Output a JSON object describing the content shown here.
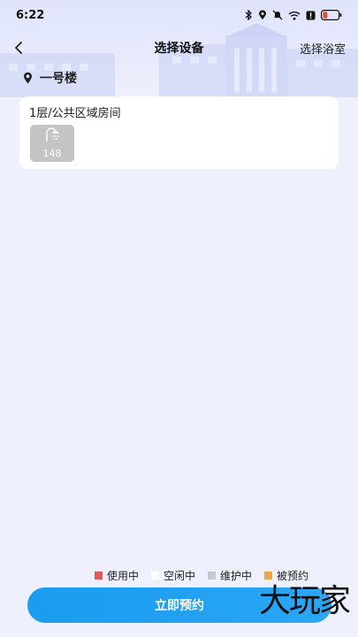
{
  "status_bar": {
    "time": "6:22",
    "icons": [
      "bluetooth-icon",
      "location-icon",
      "mute-icon",
      "wifi-icon",
      "alert-icon",
      "battery-icon"
    ]
  },
  "nav": {
    "title": "选择设备",
    "action_label": "选择浴室"
  },
  "building": {
    "name": "一号楼"
  },
  "rooms": [
    {
      "title": "1层/公共区域房间",
      "devices": [
        {
          "number": "148",
          "status": "maintenance",
          "icon": "shower-icon"
        }
      ]
    }
  ],
  "legend": [
    {
      "label": "使用中",
      "color": "#e05a53"
    },
    {
      "label": "空闲中",
      "color": "#ffffff"
    },
    {
      "label": "维护中",
      "color": "#c8c8c8"
    },
    {
      "label": "被预约",
      "color": "#f0a446"
    }
  ],
  "book_button": {
    "label": "立即预约"
  },
  "watermark": {
    "text": "大玩家"
  },
  "colors": {
    "page_bg": "#eef0fd",
    "primary": "#1a9cf0",
    "tile_maintenance": "#c4c4c4"
  }
}
